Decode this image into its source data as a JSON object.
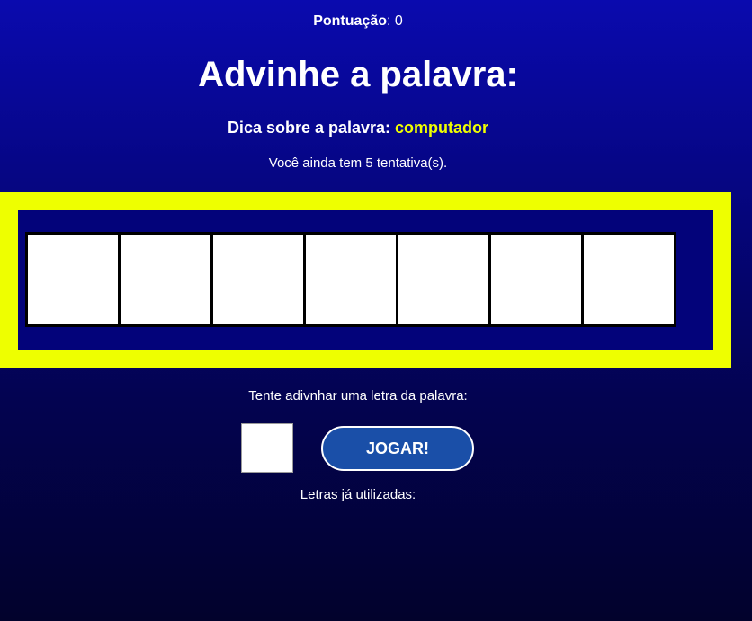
{
  "score": {
    "label": "Pontuação",
    "separator": ": ",
    "value": "0"
  },
  "title": "Advinhe a palavra:",
  "hint": {
    "label": "Dica sobre a palavra: ",
    "word": "computador"
  },
  "attempts_text": "Você ainda tem 5 tentativa(s).",
  "word_slots": [
    "",
    "",
    "",
    "",
    "",
    "",
    ""
  ],
  "prompt": "Tente adivnhar uma letra da palavra:",
  "letter_input": {
    "value": ""
  },
  "play_button_label": "JOGAR!",
  "used_letters_label": "Letras já utilizadas:",
  "colors": {
    "accent": "#eeff00",
    "button": "#1a4fa8",
    "background_top": "#0a0aae",
    "background_bottom": "#02022c"
  }
}
